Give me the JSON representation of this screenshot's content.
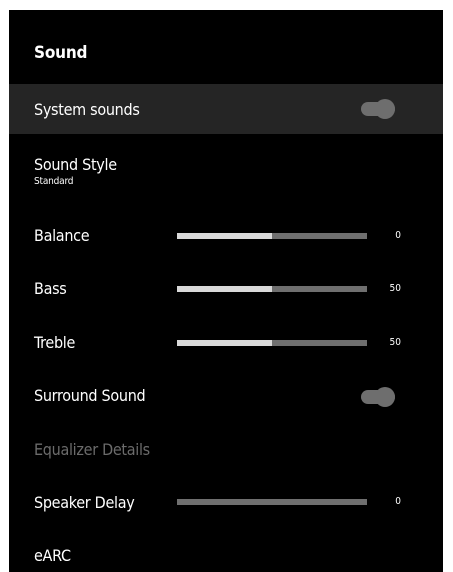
{
  "panel": {
    "title": "Sound"
  },
  "items": {
    "system_sounds": {
      "label": "System sounds",
      "toggle_on": true
    },
    "sound_style": {
      "label": "Sound Style",
      "value": "Standard"
    },
    "balance": {
      "label": "Balance",
      "value": "0",
      "fill_percent": 50
    },
    "bass": {
      "label": "Bass",
      "value": "50",
      "fill_percent": 50
    },
    "treble": {
      "label": "Treble",
      "value": "50",
      "fill_percent": 50
    },
    "surround_sound": {
      "label": "Surround Sound",
      "toggle_on": true
    },
    "equalizer_details": {
      "label": "Equalizer Details",
      "disabled": true
    },
    "speaker_delay": {
      "label": "Speaker Delay",
      "value": "0",
      "fill_percent": 0
    },
    "earc": {
      "label": "eARC"
    }
  }
}
